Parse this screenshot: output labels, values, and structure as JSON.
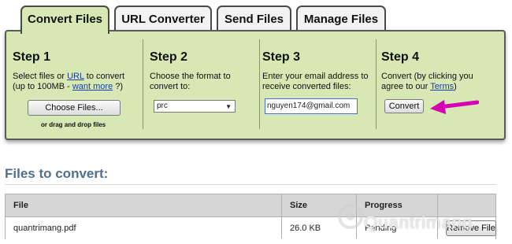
{
  "tabs": [
    {
      "label": "Convert Files",
      "active": true
    },
    {
      "label": "URL Converter",
      "active": false
    },
    {
      "label": "Send Files",
      "active": false
    },
    {
      "label": "Manage Files",
      "active": false
    }
  ],
  "steps": {
    "step1": {
      "title": "Step 1",
      "text_before": "Select files or ",
      "url_link": "URL",
      "text_middle": " to convert (up to 100MB - ",
      "want_more_link": "want more",
      "text_after": " ?)",
      "choose_button": "Choose Files...",
      "drag_text": "or drag and drop files"
    },
    "step2": {
      "title": "Step 2",
      "text": "Choose the format to convert to:",
      "selected_format": "prc",
      "caret": "▼"
    },
    "step3": {
      "title": "Step 3",
      "text": "Enter your email address to receive converted files:",
      "email_value": "nguyen174@gmail.com"
    },
    "step4": {
      "title": "Step 4",
      "text_before": "Convert (by clicking you agree to our ",
      "terms_link": "Terms",
      "text_after": ")",
      "convert_button": "Convert"
    }
  },
  "files": {
    "title": "Files to convert:",
    "columns": [
      "File",
      "Size",
      "Progress"
    ],
    "rows": [
      {
        "file": "quantrimang.pdf",
        "size": "26.0 KB",
        "progress": "Pending",
        "action": "Remove File"
      }
    ]
  },
  "watermark": {
    "text": "Quantrimang"
  },
  "colors": {
    "panel": "#d8e8b4",
    "arrow": "#d400b4",
    "link": "#1a3ea8",
    "section_title": "#4e6f8f"
  }
}
